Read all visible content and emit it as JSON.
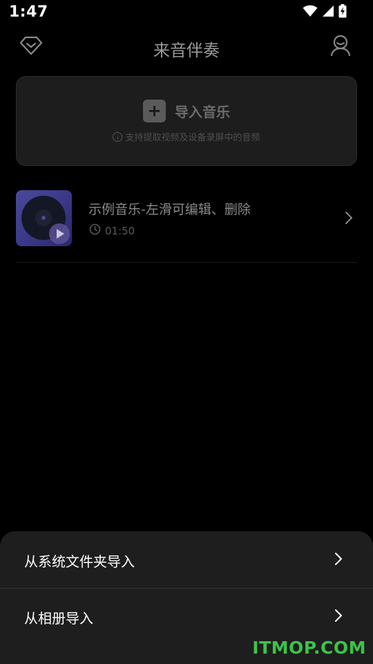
{
  "status_bar": {
    "time": "1:47",
    "icons": [
      "wifi-icon",
      "cellular-signal-icon",
      "battery-charging-icon"
    ]
  },
  "header": {
    "title": "来音伴奏",
    "left_icon": "vip-diamond-icon",
    "right_icon": "profile-icon"
  },
  "import_card": {
    "label": "导入音乐",
    "hint": "支持提取视频及设备录屏中的音频",
    "icon": "plus-icon"
  },
  "songs": [
    {
      "title": "示例音乐-左滑可编辑、删除",
      "duration": "01:50",
      "cover_icon": "vinyl-disc-icon"
    }
  ],
  "bottom_sheet": {
    "items": [
      {
        "label": "从系统文件夹导入"
      },
      {
        "label": "从相册导入"
      }
    ]
  },
  "watermark": "ITMOP.COM",
  "colors": {
    "background": "#000000",
    "sheet": "#1e1e1e",
    "watermark": "#3cc34a"
  }
}
